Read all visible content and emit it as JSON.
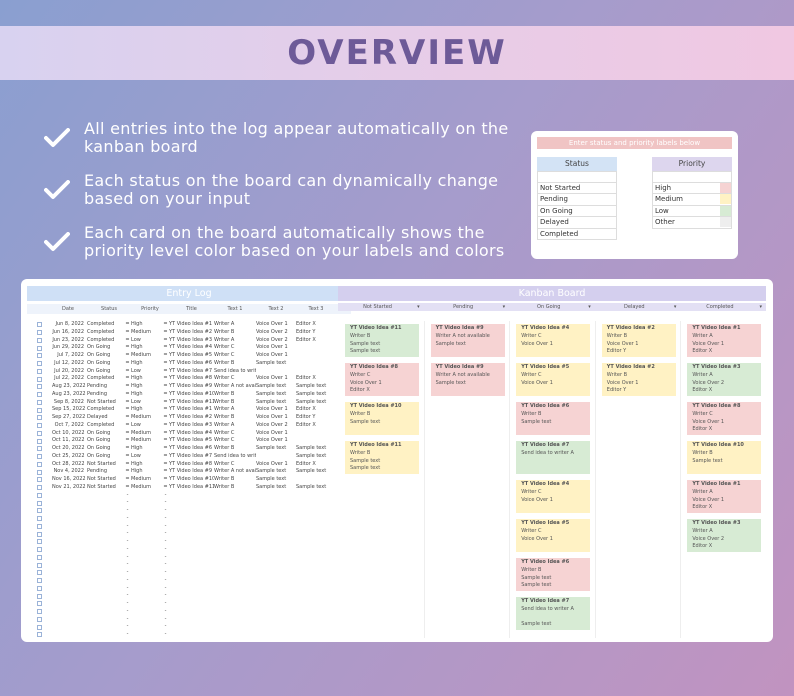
{
  "banner": {
    "title": "OVERVIEW"
  },
  "bullets": [
    "All entries into the log appear automatically on the kanban board",
    "Each status on the board can dynamically change based on your input",
    "Each card on the board automatically shows the priority level color based on your labels and colors"
  ],
  "labels": {
    "header": "Enter status and priority labels below",
    "status_title": "Status",
    "priority_title": "Priority",
    "status": [
      "Not Started",
      "Pending",
      "On Going",
      "Delayed",
      "Completed"
    ],
    "priority": [
      {
        "label": "High",
        "color": "#f6d3d3"
      },
      {
        "label": "Medium",
        "color": "#fff2c4"
      },
      {
        "label": "Low",
        "color": "#d7ebd4"
      },
      {
        "label": "Other",
        "color": "#eeeeee"
      }
    ]
  },
  "log": {
    "title": "Entry Log",
    "columns": [
      "Date",
      "Status",
      "Priority",
      "Title",
      "Text 1",
      "Text 2",
      "Text 3"
    ],
    "rows": [
      [
        "Jun 8, 2022",
        "Completed",
        "High",
        "YT Video Idea #1",
        "Writer A",
        "Voice Over 1",
        "Editor X"
      ],
      [
        "Jun 16, 2022",
        "Completed",
        "Medium",
        "YT Video Idea #2",
        "Writer B",
        "Voice Over 2",
        "Editor Y"
      ],
      [
        "Jun 23, 2022",
        "Completed",
        "Low",
        "YT Video Idea #3",
        "Writer A",
        "Voice Over 2",
        "Editor X"
      ],
      [
        "Jun 29, 2022",
        "On Going",
        "High",
        "YT Video Idea #4",
        "Writer C",
        "Voice Over 1",
        ""
      ],
      [
        "Jul 7, 2022",
        "On Going",
        "Medium",
        "YT Video Idea #5",
        "Writer C",
        "Voice Over 1",
        ""
      ],
      [
        "Jul 12, 2022",
        "On Going",
        "High",
        "YT Video Idea #6",
        "Writer B",
        "Sample text",
        ""
      ],
      [
        "Jul 20, 2022",
        "On Going",
        "Low",
        "YT Video Idea #7",
        "Send idea to writer A",
        "",
        ""
      ],
      [
        "Jul 22, 2022",
        "Completed",
        "High",
        "YT Video Idea #8",
        "Writer C",
        "Voice Over 1",
        "Editor X"
      ],
      [
        "Aug 23, 2022",
        "Pending",
        "High",
        "YT Video Idea #9",
        "Writer A not available",
        "Sample text",
        "Sample text"
      ],
      [
        "Aug 23, 2022",
        "Pending",
        "High",
        "YT Video Idea #10",
        "Writer B",
        "Sample text",
        "Sample text"
      ],
      [
        "Sep 8, 2022",
        "Not Started",
        "Low",
        "YT Video Idea #11",
        "Writer B",
        "Sample text",
        "Sample text"
      ],
      [
        "Sep 15, 2022",
        "Completed",
        "High",
        "YT Video Idea #1",
        "Writer A",
        "Voice Over 1",
        "Editor X"
      ],
      [
        "Sep 27, 2022",
        "Delayed",
        "Medium",
        "YT Video Idea #2",
        "Writer B",
        "Voice Over 1",
        "Editor Y"
      ],
      [
        "Oct 7, 2022",
        "Completed",
        "Low",
        "YT Video Idea #3",
        "Writer A",
        "Voice Over 2",
        "Editor X"
      ],
      [
        "Oct 10, 2022",
        "On Going",
        "Medium",
        "YT Video Idea #4",
        "Writer C",
        "Voice Over 1",
        ""
      ],
      [
        "Oct 11, 2022",
        "On Going",
        "Medium",
        "YT Video Idea #5",
        "Writer C",
        "Voice Over 1",
        ""
      ],
      [
        "Oct 20, 2022",
        "On Going",
        "High",
        "YT Video Idea #6",
        "Writer B",
        "Sample text",
        "Sample text"
      ],
      [
        "Oct 25, 2022",
        "On Going",
        "Low",
        "YT Video Idea #7",
        "Send idea to writer A",
        "",
        "Sample text"
      ],
      [
        "Oct 28, 2022",
        "Not Started",
        "High",
        "YT Video Idea #8",
        "Writer C",
        "Voice Over 1",
        "Editor X"
      ],
      [
        "Nov 4, 2022",
        "Pending",
        "High",
        "YT Video Idea #9",
        "Writer A not available",
        "Sample text",
        "Sample text"
      ],
      [
        "Nov 16, 2022",
        "Not Started",
        "Medium",
        "YT Video Idea #10",
        "Writer B",
        "Sample text",
        ""
      ],
      [
        "Nov 21, 2022",
        "Not Started",
        "Medium",
        "YT Video Idea #11",
        "Writer B",
        "Sample text",
        "Sample text"
      ]
    ],
    "dropdown_mark": "=",
    "empty_mark": "-"
  },
  "kanban": {
    "title": "Kanban Board",
    "columns": [
      "Not Started",
      "Pending",
      "On Going",
      "Delayed",
      "Completed"
    ],
    "cards": [
      [
        {
          "lines": [
            "YT Video Idea #11",
            "Writer B",
            "Sample text",
            "Sample text"
          ],
          "p": "g"
        },
        {
          "lines": [
            "YT Video Idea #8",
            "Writer C",
            "Voice Over 1",
            "Editor X"
          ],
          "p": "r"
        },
        {
          "lines": [
            "YT Video Idea #10",
            "Writer B",
            "Sample text",
            ""
          ],
          "p": "y"
        },
        {
          "lines": [
            "YT Video Idea #11",
            "Writer B",
            "Sample text",
            "Sample text"
          ],
          "p": "y"
        }
      ],
      [
        {
          "lines": [
            "YT Video Idea #9",
            "Writer A not available",
            "Sample text",
            ""
          ],
          "p": "r"
        },
        {
          "lines": [
            "YT Video Idea #9",
            "Writer A not available",
            "Sample text",
            ""
          ],
          "p": "r"
        }
      ],
      [
        {
          "lines": [
            "YT Video Idea #4",
            "Writer C",
            "Voice Over 1",
            ""
          ],
          "p": "y"
        },
        {
          "lines": [
            "YT Video Idea #5",
            "Writer C",
            "Voice Over 1",
            ""
          ],
          "p": "y"
        },
        {
          "lines": [
            "YT Video Idea #6",
            "Writer B",
            "Sample text",
            ""
          ],
          "p": "r"
        },
        {
          "lines": [
            "YT Video Idea #7",
            "Send idea to writer A",
            "",
            ""
          ],
          "p": "g"
        },
        {
          "lines": [
            "YT Video Idea #4",
            "Writer C",
            "Voice Over 1",
            ""
          ],
          "p": "y"
        },
        {
          "lines": [
            "YT Video Idea #5",
            "Writer C",
            "Voice Over 1",
            ""
          ],
          "p": "y"
        },
        {
          "lines": [
            "YT Video Idea #6",
            "Writer B",
            "Sample text",
            "Sample text"
          ],
          "p": "r"
        },
        {
          "lines": [
            "YT Video Idea #7",
            "Send idea to writer A",
            "",
            "Sample text"
          ],
          "p": "g"
        }
      ],
      [
        {
          "lines": [
            "YT Video Idea #2",
            "Writer B",
            "Voice Over 1",
            "Editor Y"
          ],
          "p": "y"
        },
        {
          "lines": [
            "YT Video Idea #2",
            "Writer B",
            "Voice Over 1",
            "Editor Y"
          ],
          "p": "y"
        }
      ],
      [
        {
          "lines": [
            "YT Video Idea #1",
            "Writer A",
            "Voice Over 1",
            "Editor X"
          ],
          "p": "r"
        },
        {
          "lines": [
            "YT Video Idea #3",
            "Writer A",
            "Voice Over 2",
            "Editor X"
          ],
          "p": "g"
        },
        {
          "lines": [
            "YT Video Idea #8",
            "Writer C",
            "Voice Over 1",
            "Editor X"
          ],
          "p": "r"
        },
        {
          "lines": [
            "YT Video Idea #10",
            "Writer B",
            "Sample text",
            ""
          ],
          "p": "y"
        },
        {
          "lines": [
            "YT Video Idea #1",
            "Writer A",
            "Voice Over 1",
            "Editor X"
          ],
          "p": "r"
        },
        {
          "lines": [
            "YT Video Idea #3",
            "Writer A",
            "Voice Over 2",
            "Editor X"
          ],
          "p": "g"
        }
      ]
    ]
  }
}
